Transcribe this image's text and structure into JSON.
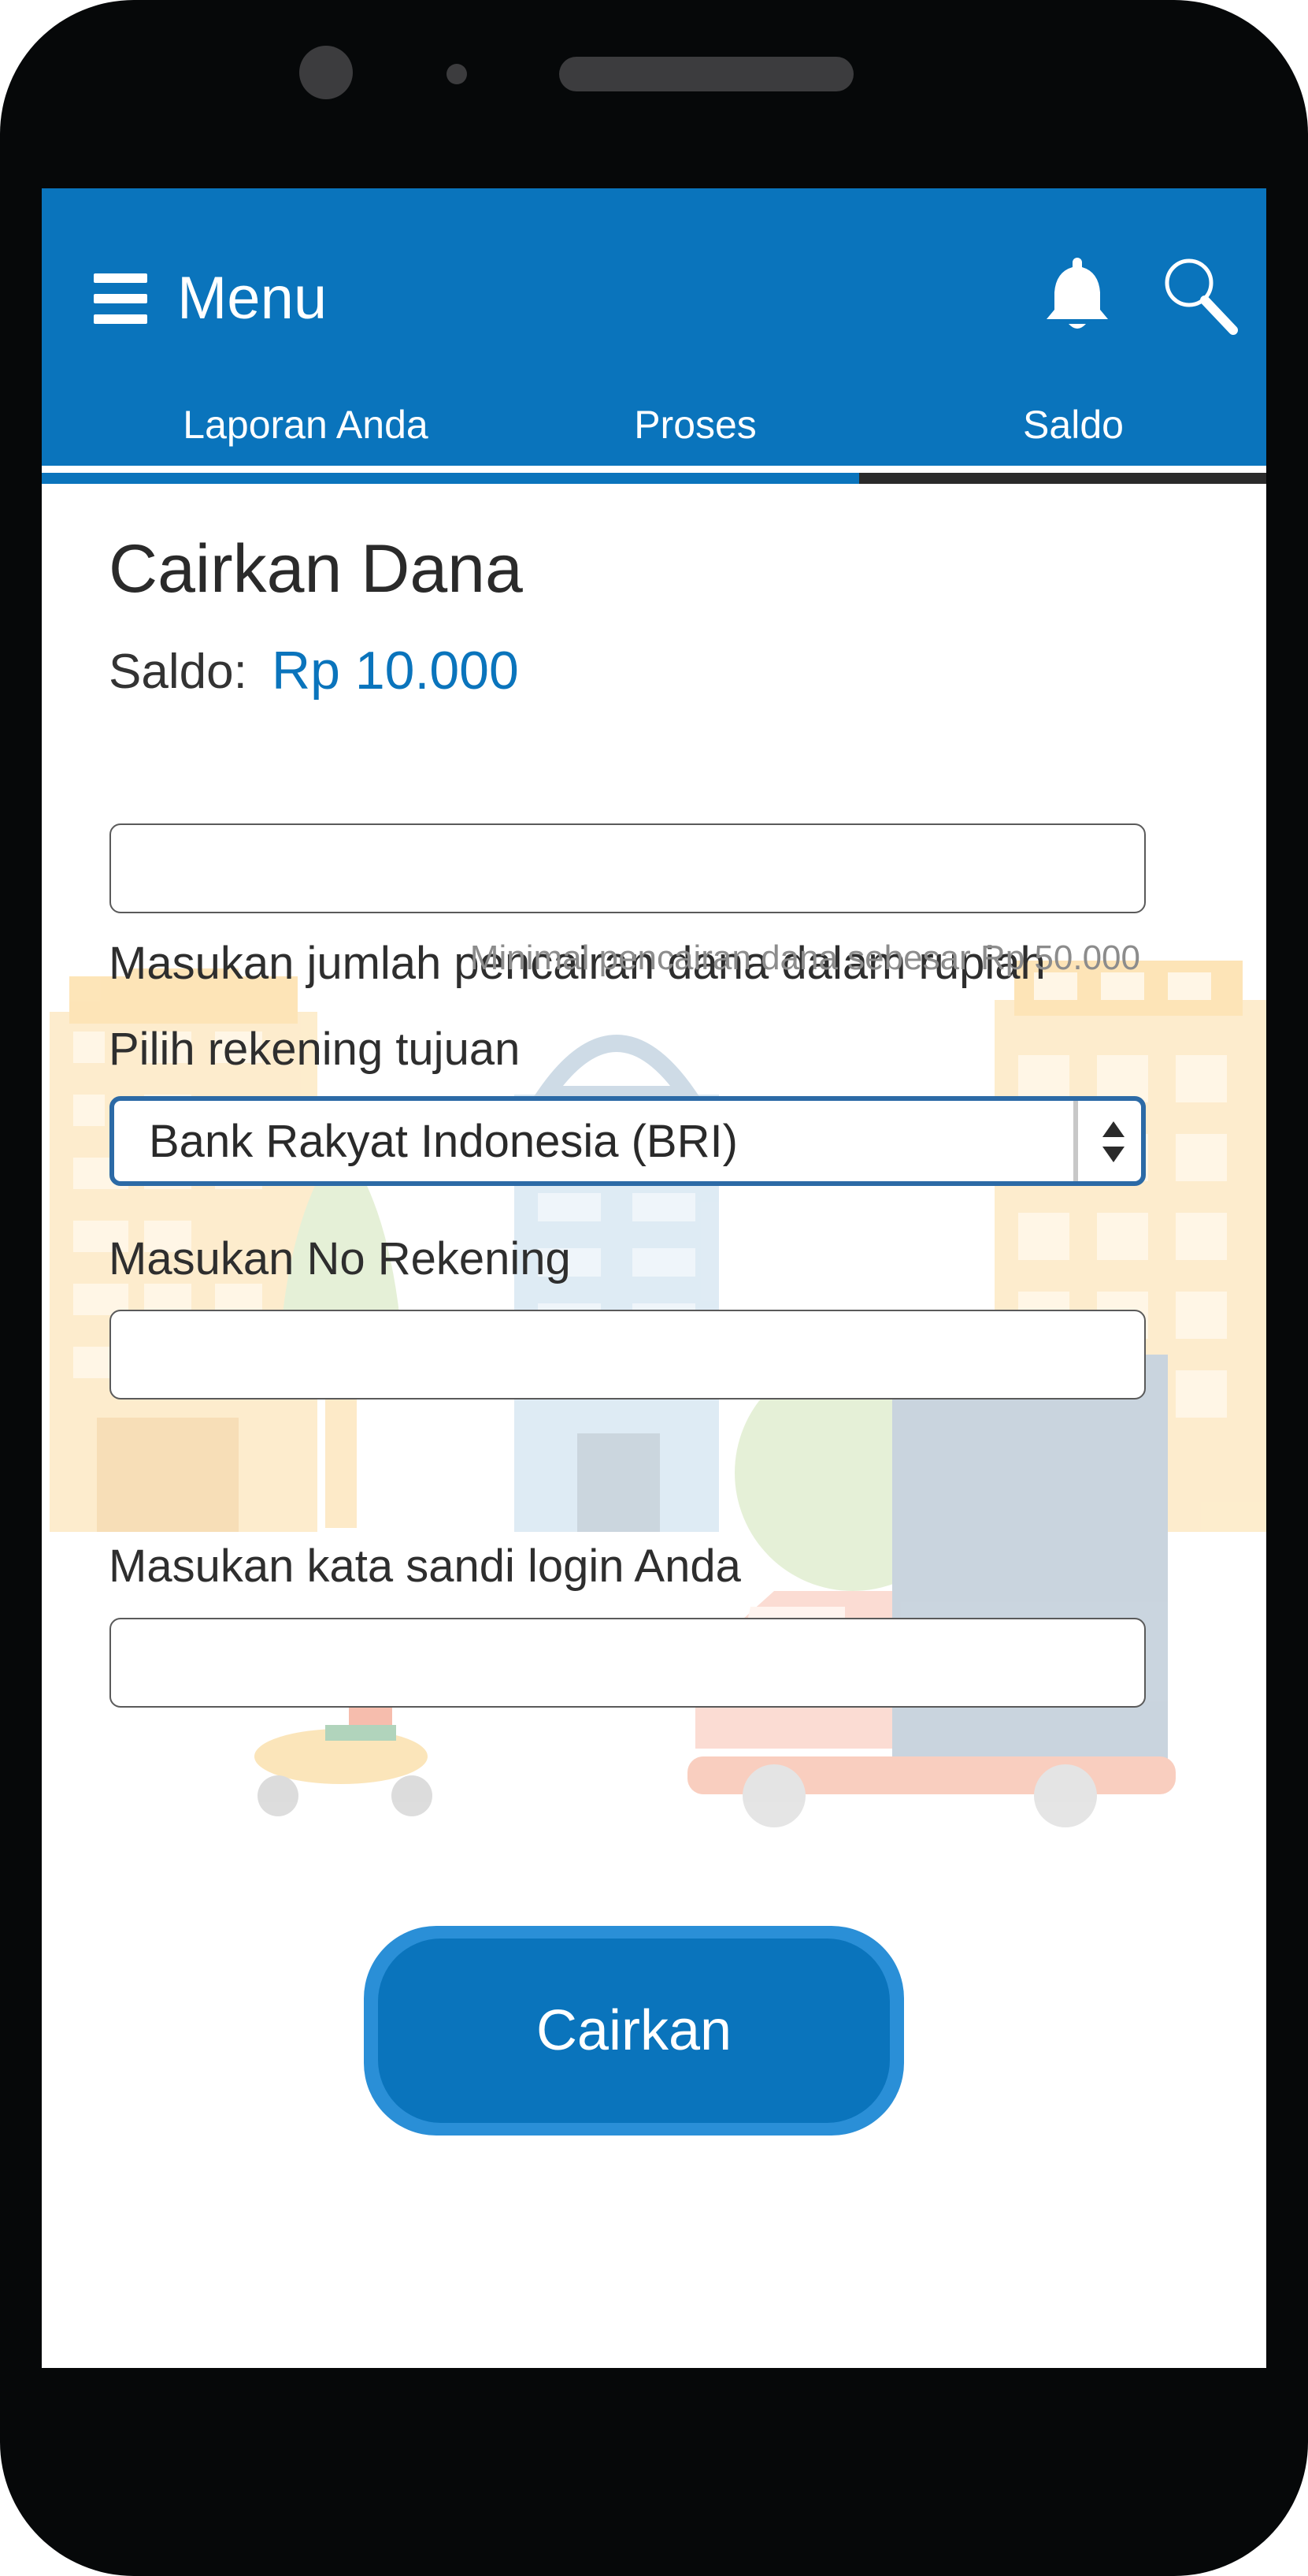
{
  "header": {
    "menu_label": "Menu",
    "icons": [
      "hamburger-icon",
      "bell-icon",
      "search-icon"
    ]
  },
  "tabs": [
    {
      "label": "Laporan Anda",
      "active": false
    },
    {
      "label": "Proses",
      "active": false
    },
    {
      "label": "Saldo",
      "active": true
    }
  ],
  "form": {
    "title": "Cairkan Dana",
    "saldo_label": "Saldo:",
    "saldo_value": "Rp 10.000",
    "amount_label": "Masukan jumlah pencairan dana dalam rupiah",
    "amount_value": "",
    "amount_hint": "Minimal pencairan dana sebesar Rp 50.000",
    "bank_label": "Pilih rekening tujuan",
    "bank_selected": "Bank Rakyat Indonesia (BRI)",
    "account_label": "Masukan No Rekening",
    "account_value": "",
    "password_label": "Masukan kata sandi login Anda",
    "password_value": "",
    "submit_label": "Cairkan"
  },
  "colors": {
    "primary": "#0a74bc",
    "button_border": "#2a8fd7",
    "select_focus": "#2c6aa6",
    "phone_body": "#060809"
  }
}
